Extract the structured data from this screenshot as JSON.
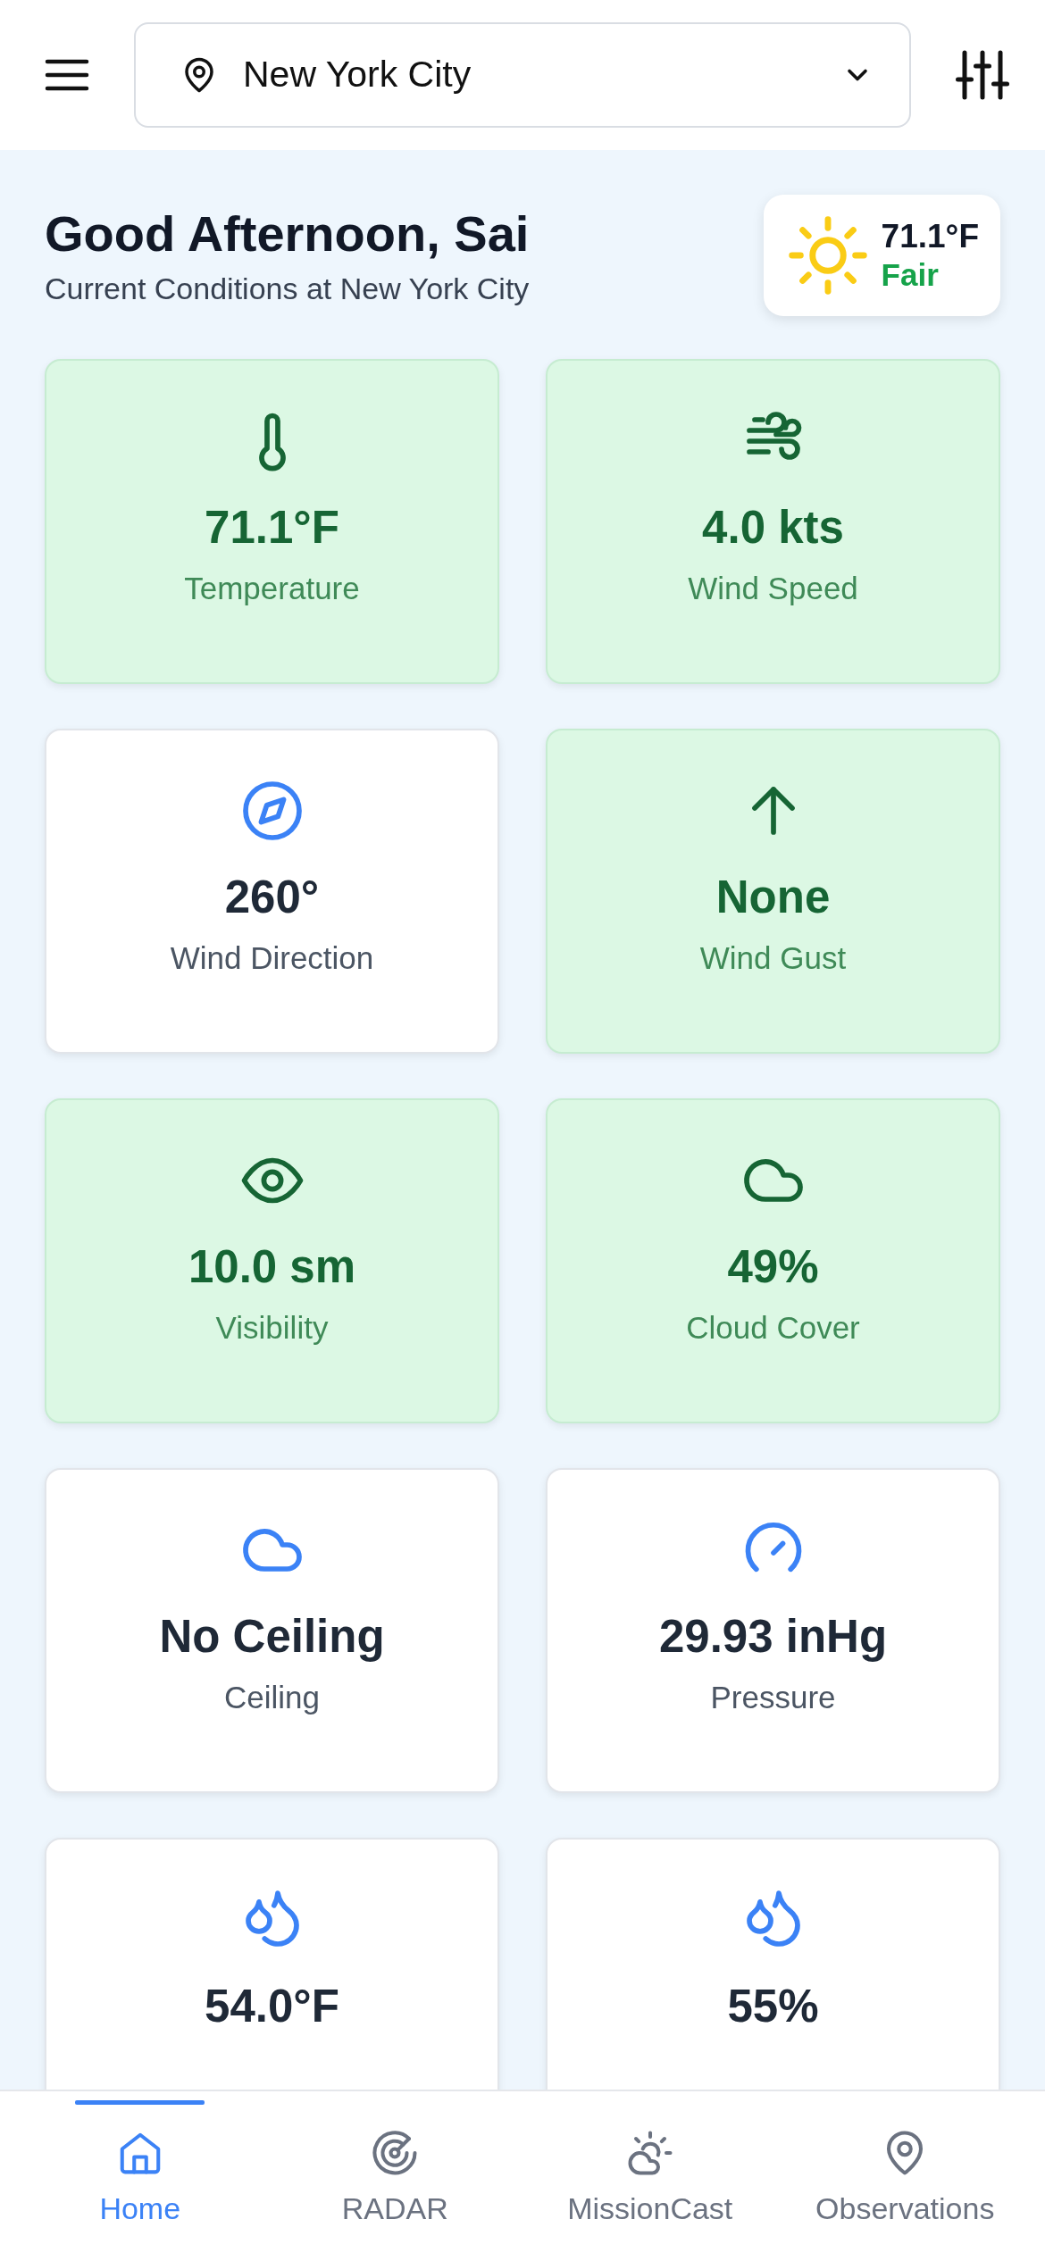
{
  "header": {
    "location": "New York City"
  },
  "greeting": {
    "title": "Good Afternoon, Sai",
    "subtitle": "Current Conditions at New York City"
  },
  "current": {
    "temperature": "71.1°F",
    "condition": "Fair"
  },
  "cards": [
    {
      "value": "71.1°F",
      "label": "Temperature",
      "highlighted": true
    },
    {
      "value": "4.0 kts",
      "label": "Wind Speed",
      "highlighted": true
    },
    {
      "value": "260°",
      "label": "Wind Direction",
      "highlighted": false
    },
    {
      "value": "None",
      "label": "Wind Gust",
      "highlighted": true
    },
    {
      "value": "10.0 sm",
      "label": "Visibility",
      "highlighted": true
    },
    {
      "value": "49%",
      "label": "Cloud Cover",
      "highlighted": true
    },
    {
      "value": "No Ceiling",
      "label": "Ceiling",
      "highlighted": false
    },
    {
      "value": "29.93 inHg",
      "label": "Pressure",
      "highlighted": false
    },
    {
      "value": "54.0°F",
      "highlighted": false
    },
    {
      "value": "55%",
      "highlighted": false
    }
  ],
  "nav": [
    {
      "label": "Home",
      "selected": true
    },
    {
      "label": "RADAR",
      "selected": false
    },
    {
      "label": "MissionCast",
      "selected": false
    },
    {
      "label": "Observations",
      "selected": false
    }
  ]
}
